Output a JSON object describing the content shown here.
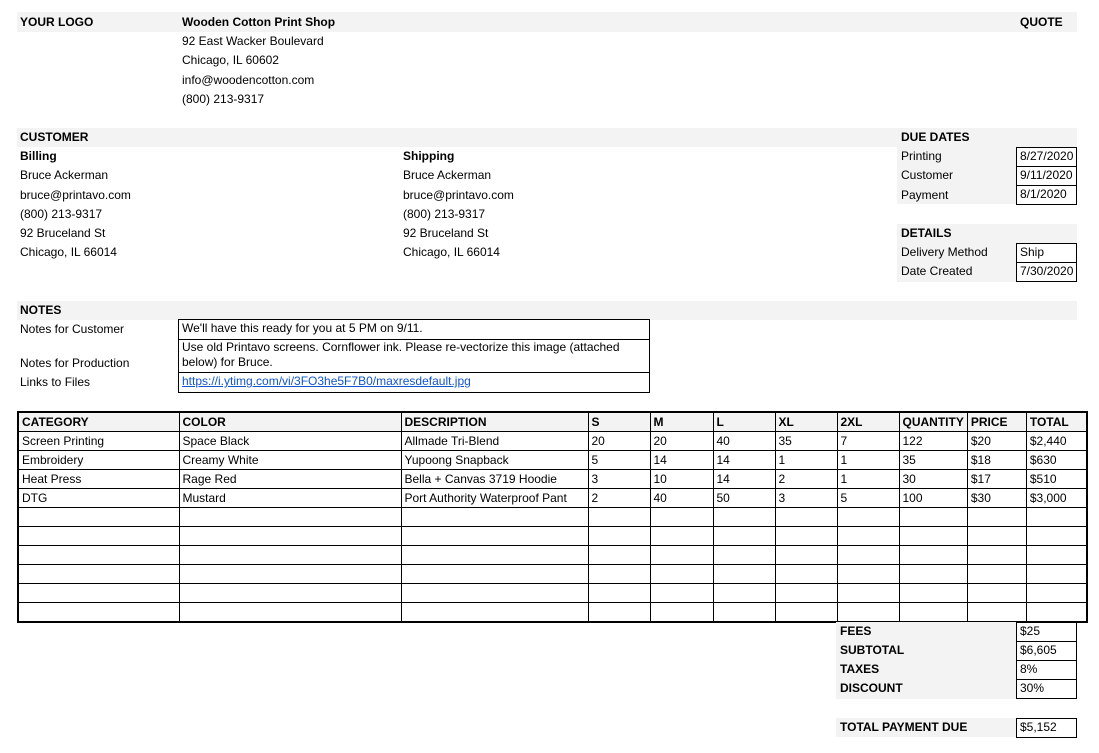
{
  "header": {
    "logo": "YOUR LOGO",
    "shop_name": "Wooden Cotton Print Shop",
    "address": "92 East Wacker Boulevard",
    "city": "Chicago, IL 60602",
    "email": "info@woodencotton.com",
    "phone": "(800) 213-9317",
    "doc_type": "QUOTE"
  },
  "customer": {
    "title": "CUSTOMER",
    "billing": {
      "label": "Billing",
      "name": "Bruce Ackerman",
      "email": "bruce@printavo.com",
      "phone": "(800) 213-9317",
      "street": "92 Bruceland St",
      "city": "Chicago, IL 66014"
    },
    "shipping": {
      "label": "Shipping",
      "name": "Bruce Ackerman",
      "email": "bruce@printavo.com",
      "phone": "(800) 213-9317",
      "street": "92 Bruceland St",
      "city": "Chicago, IL 66014"
    }
  },
  "due_dates": {
    "title": "DUE DATES",
    "items": [
      {
        "label": "Printing",
        "value": "8/27/2020"
      },
      {
        "label": "Customer",
        "value": "9/11/2020"
      },
      {
        "label": "Payment",
        "value": "8/1/2020"
      }
    ]
  },
  "details": {
    "title": "DETAILS",
    "items": [
      {
        "label": "Delivery Method",
        "value": "Ship"
      },
      {
        "label": "Date Created",
        "value": "7/30/2020"
      }
    ]
  },
  "notes": {
    "title": "NOTES",
    "customer_label": "Notes for Customer",
    "customer_value": "We'll have this ready for you at 5 PM on 9/11.",
    "production_label": "Notes for Production",
    "production_value_1": "Use old Printavo screens. Cornflower ink. Please re-vectorize this image (attached",
    "production_value_2": "below) for Bruce.",
    "links_label": "Links to Files",
    "links_value": "https://i.ytimg.com/vi/3FO3he5F7B0/maxresdefault.jpg"
  },
  "table": {
    "headers": [
      "CATEGORY",
      "COLOR",
      "DESCRIPTION",
      "S",
      "M",
      "L",
      "XL",
      "2XL",
      "QUANTITY",
      "PRICE",
      "TOTAL"
    ],
    "rows": [
      [
        "Screen Printing",
        "Space Black",
        "Allmade Tri-Blend",
        "20",
        "20",
        "40",
        "35",
        "7",
        "122",
        "$20",
        "$2,440"
      ],
      [
        "Embroidery",
        "Creamy White",
        "Yupoong Snapback",
        "5",
        "14",
        "14",
        "1",
        "1",
        "35",
        "$18",
        "$630"
      ],
      [
        "Heat Press",
        "Rage Red",
        "Bella + Canvas 3719 Hoodie",
        "3",
        "10",
        "14",
        "2",
        "1",
        "30",
        "$17",
        "$510"
      ],
      [
        "DTG",
        "Mustard",
        "Port Authority Waterproof Pant",
        "2",
        "40",
        "50",
        "3",
        "5",
        "100",
        "$30",
        "$3,000"
      ]
    ],
    "empty_rows": 6
  },
  "totals": {
    "items": [
      {
        "label": "FEES",
        "value": "$25"
      },
      {
        "label": "SUBTOTAL",
        "value": "$6,605"
      },
      {
        "label": "TAXES",
        "value": "8%"
      },
      {
        "label": "DISCOUNT",
        "value": "30%"
      }
    ],
    "due_label": "TOTAL PAYMENT DUE",
    "due_value": "$5,152"
  }
}
